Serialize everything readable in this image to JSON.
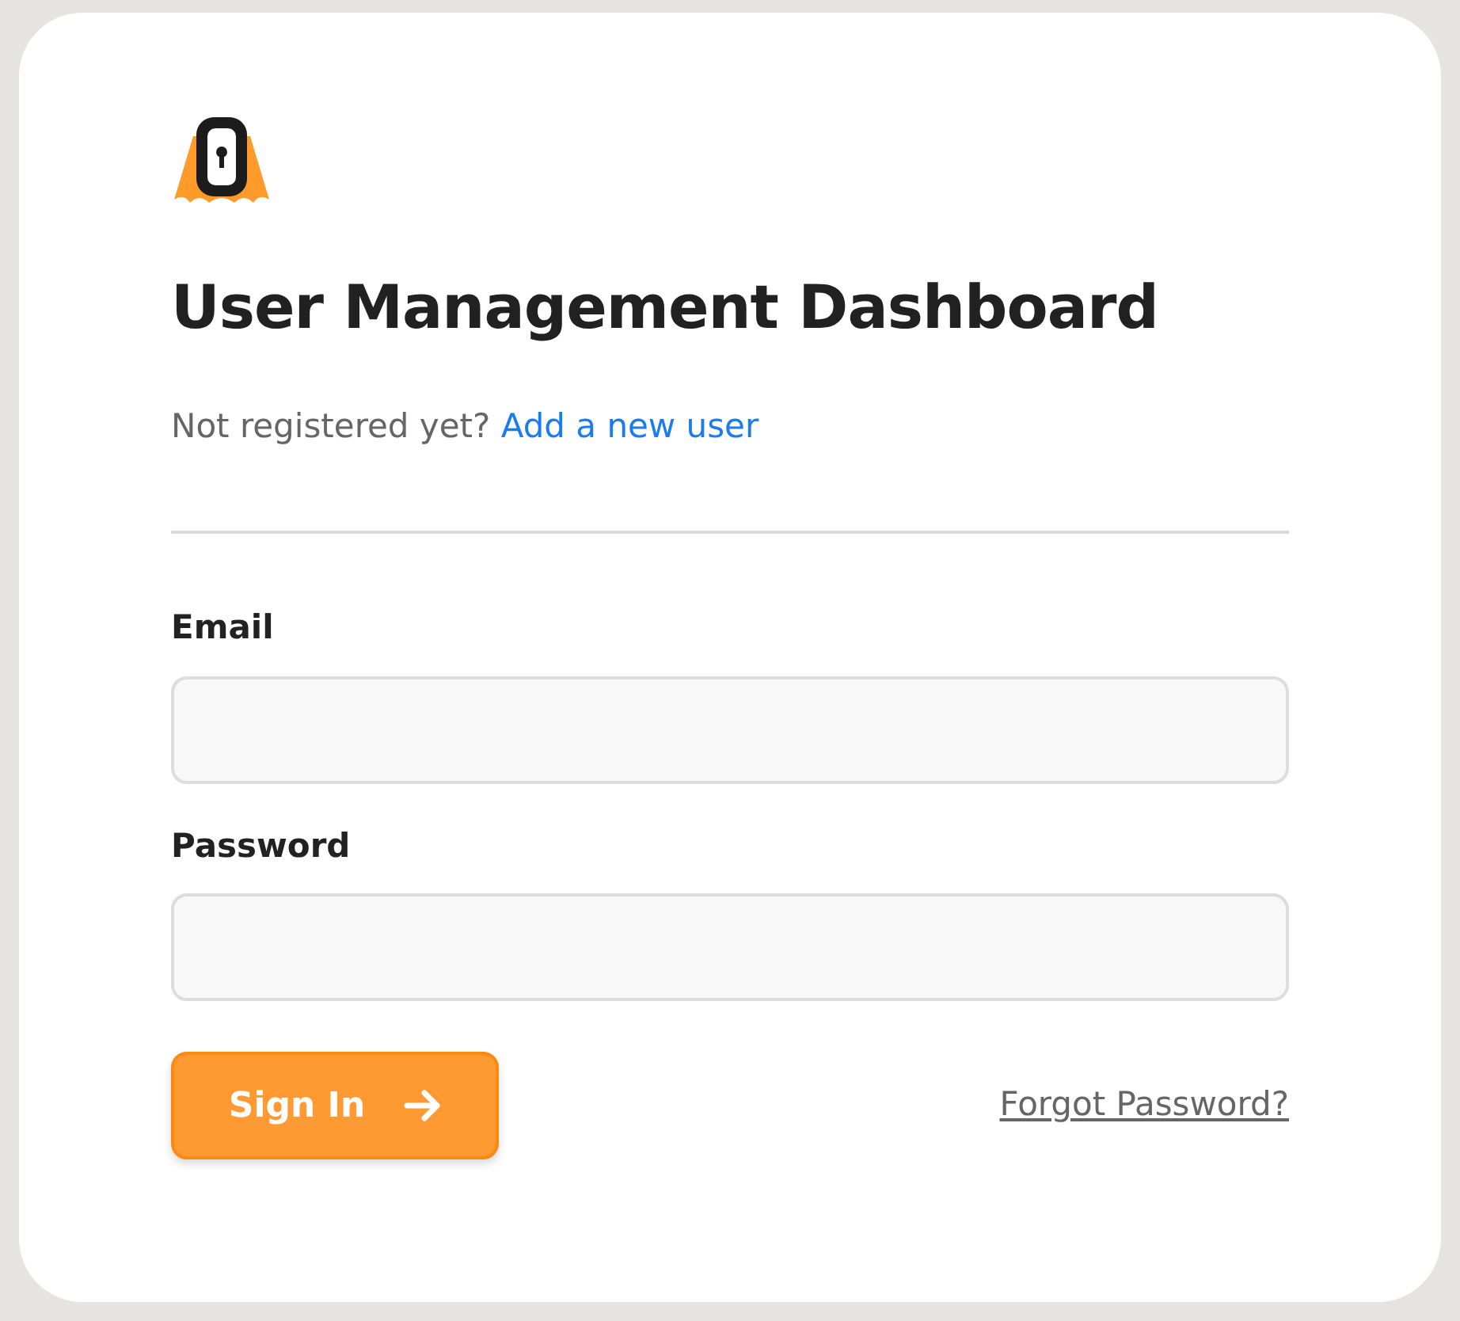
{
  "title": "User Management Dashboard",
  "register": {
    "prompt": "Not registered yet?",
    "link": "Add a new user"
  },
  "fields": [
    {
      "label": "Email"
    },
    {
      "label": "Password"
    }
  ],
  "sign_in": {
    "label": "Sign In"
  },
  "forgot": {
    "label": "Forgot Password?"
  }
}
